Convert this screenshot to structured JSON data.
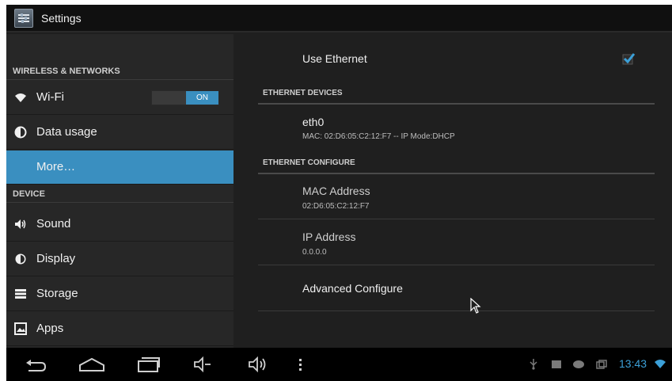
{
  "actionbar": {
    "title": "Settings",
    "icon": "settings-app-icon"
  },
  "sidebar": {
    "categories": [
      {
        "label": "WIRELESS & NETWORKS"
      },
      {
        "label": "DEVICE"
      }
    ],
    "items": [
      {
        "label": "Wi-Fi",
        "icon": "wifi-icon",
        "toggle_label": "ON"
      },
      {
        "label": "Data usage",
        "icon": "data-usage-icon"
      },
      {
        "label": "More…",
        "icon": "",
        "selected": true
      },
      {
        "label": "Sound",
        "icon": "speaker-icon"
      },
      {
        "label": "Display",
        "icon": "display-icon"
      },
      {
        "label": "Storage",
        "icon": "storage-icon"
      },
      {
        "label": "Apps",
        "icon": "apps-icon"
      }
    ]
  },
  "main": {
    "use_ethernet": {
      "label": "Use Ethernet",
      "checked": true
    },
    "ethernet_devices": {
      "header": "ETHERNET DEVICES",
      "device_name": "eth0",
      "device_info": "MAC: 02:D6:05:C2:12:F7 -- IP Mode:DHCP"
    },
    "ethernet_configure": {
      "header": "ETHERNET CONFIGURE",
      "mac_label": "MAC Address",
      "mac_value": "02:D6:05:C2:12:F7",
      "ip_label": "IP Address",
      "ip_value": "0.0.0.0",
      "advanced_label": "Advanced Configure"
    }
  },
  "navbar": {
    "buttons": [
      "back-icon",
      "home-icon",
      "recent-apps-icon",
      "volume-down-icon",
      "volume-up-icon",
      "menu-icon"
    ],
    "status_icons": [
      "usb-icon",
      "sd-card-icon",
      "gamepad-icon",
      "screenshot-icon",
      "wifi-status-icon"
    ],
    "clock": "13:43"
  },
  "colors": {
    "accent": "#3a8fc0",
    "clock": "#3ca0d8",
    "background": "#1f1f1f"
  }
}
